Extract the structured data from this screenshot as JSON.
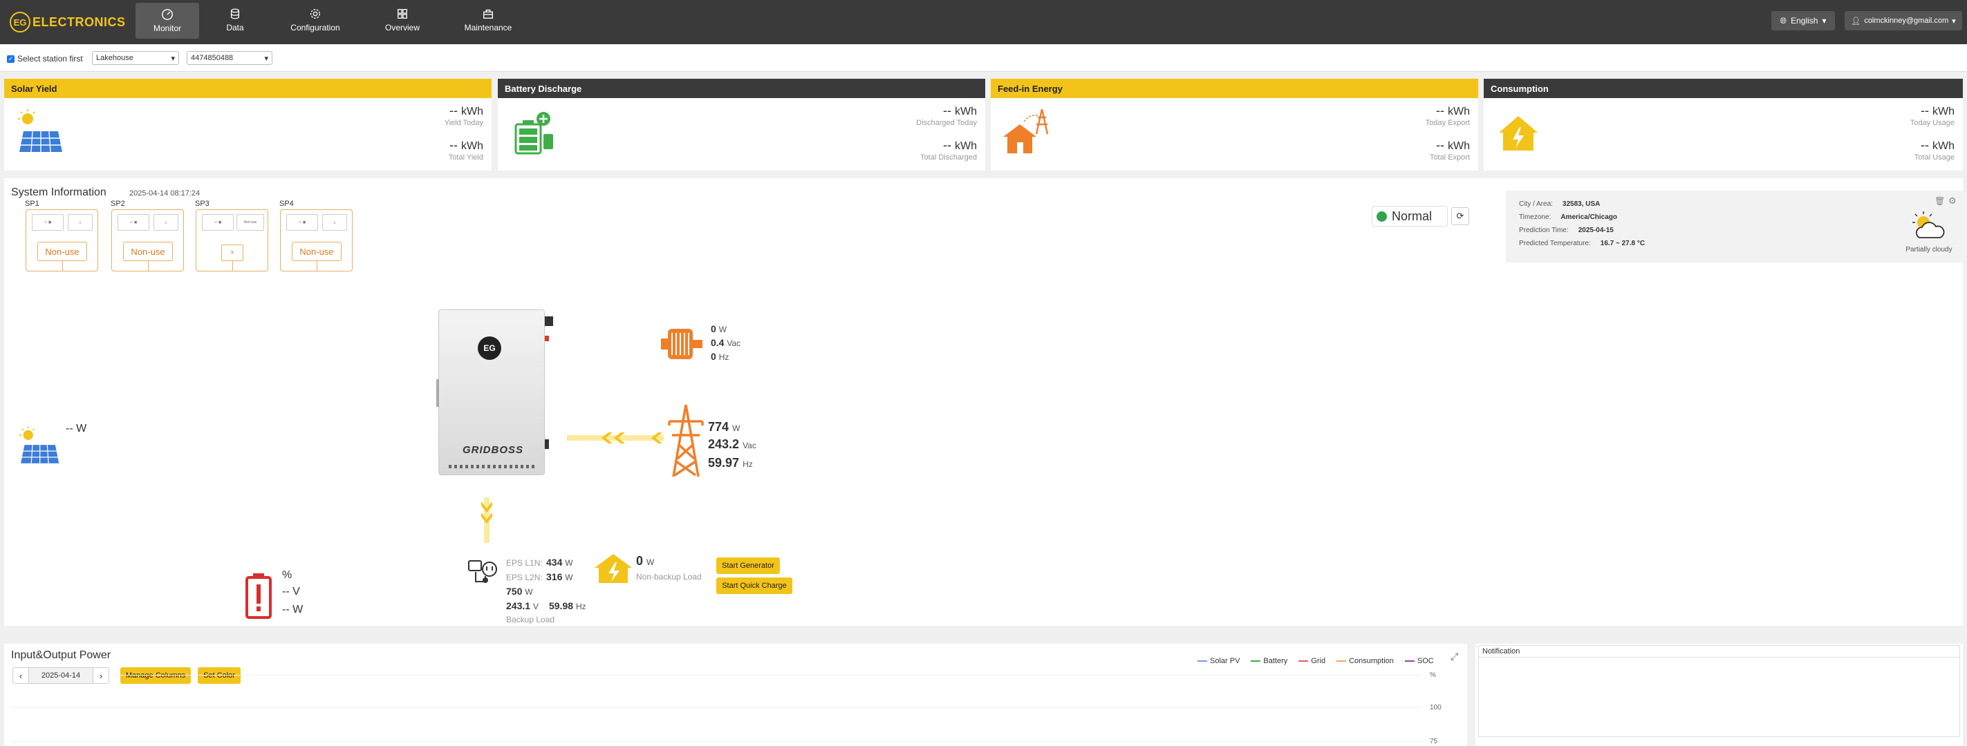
{
  "brand": {
    "badge": "EG",
    "name": "ELECTRONICS"
  },
  "nav": {
    "items": [
      {
        "label": "Monitor",
        "icon": "gauge-icon"
      },
      {
        "label": "Data",
        "icon": "database-icon"
      },
      {
        "label": "Configuration",
        "icon": "gear-icon"
      },
      {
        "label": "Overview",
        "icon": "grid-icon"
      },
      {
        "label": "Maintenance",
        "icon": "toolbox-icon"
      }
    ],
    "language": "English",
    "user": "colmckinney@gmail.com"
  },
  "station": {
    "checkbox_label": "Select station first",
    "station_name": "Lakehouse",
    "serial": "4474850488"
  },
  "cards": [
    {
      "title": "Solar Yield",
      "top_value": "--",
      "top_unit": "kWh",
      "top_label": "Yield Today",
      "bottom_value": "--",
      "bottom_unit": "kWh",
      "bottom_label": "Total Yield"
    },
    {
      "title": "Battery Discharge",
      "top_value": "--",
      "top_unit": "kWh",
      "top_label": "Discharged Today",
      "bottom_value": "--",
      "bottom_unit": "kWh",
      "bottom_label": "Total Discharged"
    },
    {
      "title": "Feed-in Energy",
      "top_value": "--",
      "top_unit": "kWh",
      "top_label": "Today Export",
      "bottom_value": "--",
      "bottom_unit": "kWh",
      "bottom_label": "Total Export"
    },
    {
      "title": "Consumption",
      "top_value": "--",
      "top_unit": "kWh",
      "top_label": "Today Usage",
      "bottom_value": "--",
      "bottom_unit": "kWh",
      "bottom_label": "Total Usage"
    }
  ],
  "system": {
    "title": "System Information",
    "timestamp": "2025-04-14 08:17:24",
    "smart_ports": [
      {
        "label": "SP1",
        "mode": "Non-use"
      },
      {
        "label": "SP2",
        "mode": "Non-use"
      },
      {
        "label": "SP3",
        "mode": "Non-use"
      },
      {
        "label": "SP4",
        "mode": "Non-use"
      }
    ],
    "status": "Normal",
    "device_name": "GRIDBOSS",
    "device_badge": "EG",
    "solar": {
      "value": "--",
      "unit": "W"
    },
    "generator": {
      "power": "0",
      "power_unit": "W",
      "voltage": "0.4",
      "voltage_unit": "Vac",
      "freq": "0",
      "freq_unit": "Hz"
    },
    "grid": {
      "power": "774",
      "power_unit": "W",
      "voltage": "243.2",
      "voltage_unit": "Vac",
      "freq": "59.97",
      "freq_unit": "Hz"
    },
    "battery": {
      "soc": "",
      "soc_unit": "%",
      "voltage": "--",
      "voltage_unit": "V",
      "power": "--",
      "power_unit": "W"
    },
    "backup": {
      "l1n_label": "EPS L1N:",
      "l1n_value": "434",
      "l1n_unit": "W",
      "l2n_label": "EPS L2N:",
      "l2n_value": "316",
      "l2n_unit": "W",
      "total": "750",
      "total_unit": "W",
      "voltage": "243.1",
      "voltage_unit": "V",
      "freq": "59.98",
      "freq_unit": "Hz",
      "label": "Backup Load"
    },
    "nonbackup": {
      "value": "0",
      "unit": "W",
      "label": "Non-backup Load"
    },
    "buttons": {
      "start_generator": "Start Generator",
      "start_quick_charge": "Start Quick Charge"
    }
  },
  "weather": {
    "city_label": "City / Area:",
    "city": "32583, USA",
    "tz_label": "Timezone:",
    "tz": "America/Chicago",
    "pred_label": "Prediction Time:",
    "pred": "2025-04-15",
    "temp_label": "Predicted Temperature:",
    "temp": "16.7 ~ 27.8 °C",
    "condition": "Partially cloudy"
  },
  "chart": {
    "title": "Input&Output Power",
    "date": "2025-04-14",
    "manage_columns": "Manage Columns",
    "set_color": "Set Color",
    "legend": [
      {
        "name": "Solar PV",
        "color": "#6e9bea"
      },
      {
        "name": "Battery",
        "color": "#3fae49"
      },
      {
        "name": "Grid",
        "color": "#e55b5b"
      },
      {
        "name": "Consumption",
        "color": "#f2a55a"
      },
      {
        "name": "SOC",
        "color": "#9b3fb0"
      }
    ],
    "y_right_unit": "%",
    "y_ticks": [
      "100",
      "75"
    ]
  },
  "notification": {
    "title": "Notification"
  },
  "colors": {
    "accent": "#f2c41a",
    "nav_bg": "#3a3a3a",
    "orange": "#f07f2a",
    "status_ok": "#2ea44f",
    "alert_red": "#d92d2d"
  }
}
